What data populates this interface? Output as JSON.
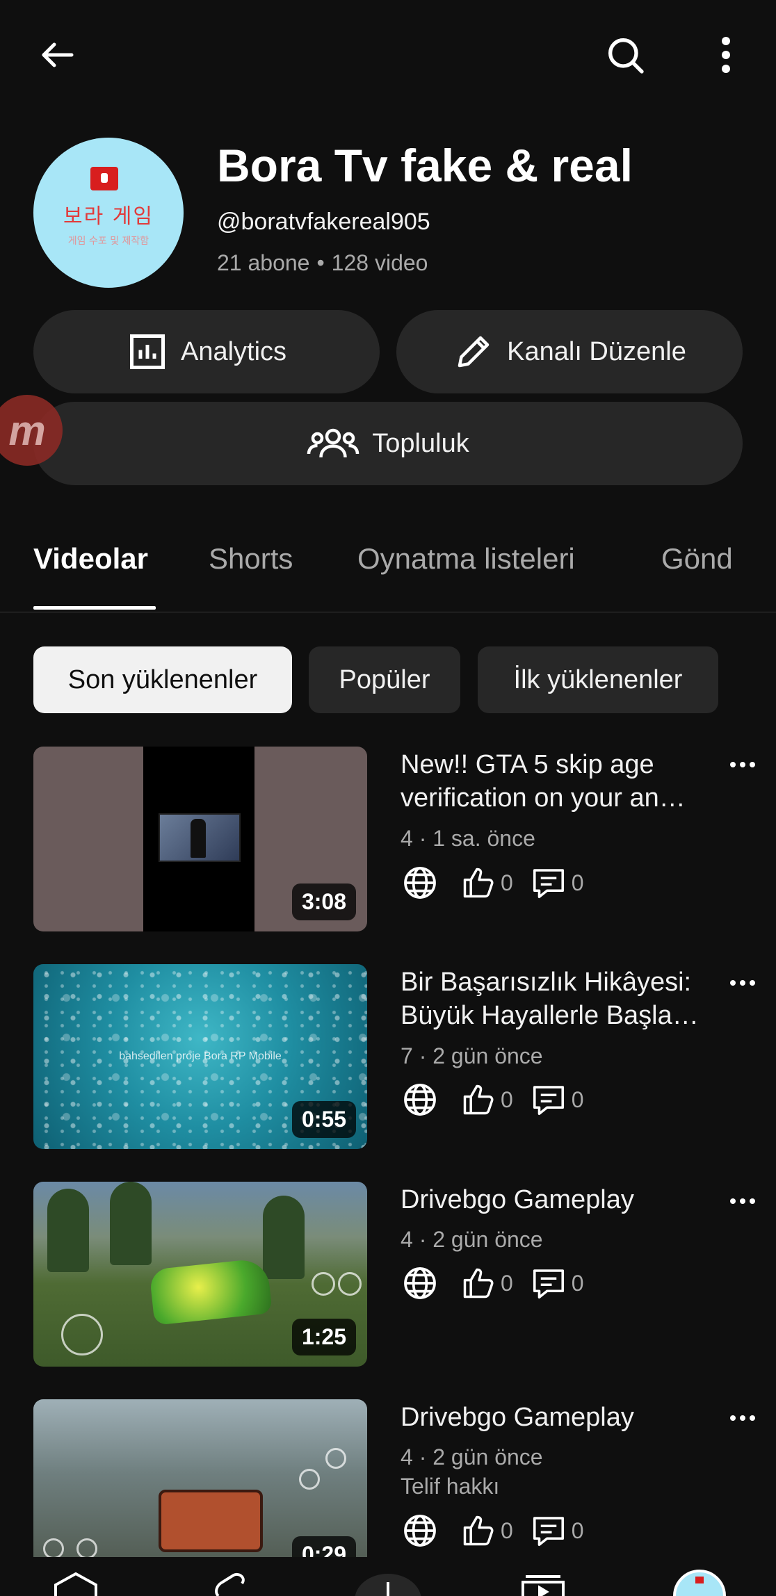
{
  "channel": {
    "name": "Bora Tv fake & real",
    "handle": "@boratvfakereal905",
    "subscribers": "21 abone",
    "videos": "128 video",
    "separator": "•",
    "avatar_text": "보라 게임",
    "avatar_subtext": "게임 수포 및 제작함",
    "avatar_color": "#a8e6f7"
  },
  "actions": {
    "analytics": "Analytics",
    "edit_channel": "Kanalı Düzenle",
    "community": "Topluluk"
  },
  "overlay_badge": "m",
  "tabs": [
    {
      "label": "Videolar",
      "active": true
    },
    {
      "label": "Shorts",
      "active": false
    },
    {
      "label": "Oynatma listeleri",
      "active": false
    },
    {
      "label": "Gönd",
      "active": false
    }
  ],
  "filters": [
    {
      "label": "Son yüklenenler",
      "selected": true
    },
    {
      "label": "Popüler",
      "selected": false
    },
    {
      "label": "İlk yüklenenler",
      "selected": false
    }
  ],
  "videos": [
    {
      "title_line1": "New!! GTA 5 skip age",
      "title_line2": "verification on your an…",
      "meta": "4 · 1 sa. önce",
      "note": "",
      "duration": "3:08",
      "likes": "0",
      "comments": "0"
    },
    {
      "title_line1": "Bir Başarısızlık Hikâyesi:",
      "title_line2": "Büyük Hayallerle Başla…",
      "meta": "7 · 2 gün önce",
      "note": "",
      "duration": "0:55",
      "likes": "0",
      "comments": "0",
      "watermark": "bahsedilen proje Bora RP Mobile"
    },
    {
      "title_line1": "Drivebgo Gameplay",
      "title_line2": "",
      "meta": "4 · 2 gün önce",
      "note": "",
      "duration": "1:25",
      "likes": "0",
      "comments": "0"
    },
    {
      "title_line1": "Drivebgo Gameplay",
      "title_line2": "",
      "meta": "4 · 2 gün önce",
      "note": "Telif hakkı",
      "duration": "0:29",
      "likes": "0",
      "comments": "0"
    }
  ],
  "icons": {
    "back": "arrow-left-icon",
    "search": "search-icon",
    "more": "more-vert-icon",
    "visibility": "globe-icon",
    "like": "thumb-up-icon",
    "comment": "comment-icon"
  }
}
